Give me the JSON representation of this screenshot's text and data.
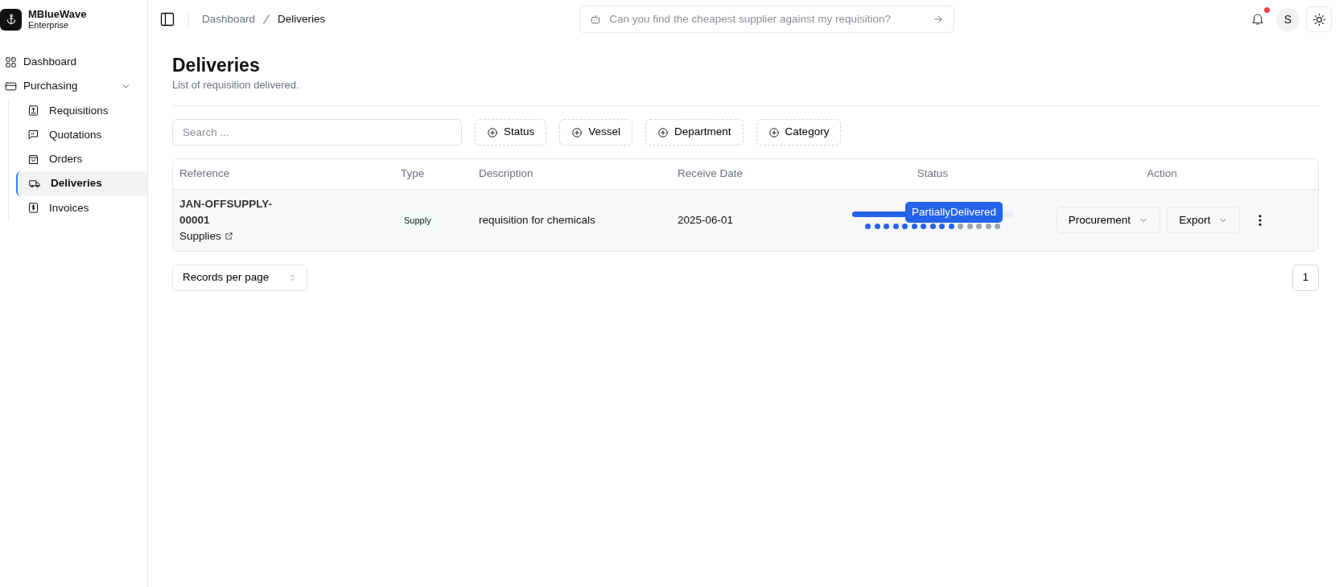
{
  "brand": {
    "name": "MBlueWave",
    "subtitle": "Enterprise"
  },
  "sidebar": {
    "items": [
      {
        "label": "Dashboard",
        "selected": false
      },
      {
        "label": "Purchasing",
        "selected": false,
        "expanded": true,
        "children": [
          {
            "label": "Requisitions",
            "selected": false
          },
          {
            "label": "Quotations",
            "selected": false
          },
          {
            "label": "Orders",
            "selected": false
          },
          {
            "label": "Deliveries",
            "selected": true
          },
          {
            "label": "Invoices",
            "selected": false
          }
        ]
      }
    ]
  },
  "breadcrumb": [
    "Dashboard",
    "Deliveries"
  ],
  "assistant": {
    "placeholder": "Can you find the cheapest supplier against my requisition?"
  },
  "notifications": {
    "unread": true
  },
  "avatar": {
    "initial": "S"
  },
  "page": {
    "title": "Deliveries",
    "subtitle": "List of requisition delivered."
  },
  "search": {
    "placeholder": "Search ..."
  },
  "filters": [
    "Status",
    "Vessel",
    "Department",
    "Category"
  ],
  "table": {
    "columns": [
      "Reference",
      "Type",
      "Description",
      "Receive Date",
      "Status",
      "Action"
    ],
    "rows": [
      {
        "reference": "JAN-OFFSUPPLY-00001",
        "group": "Supplies",
        "type": "Supply",
        "description": "requisition for chemicals",
        "receive_date": "2025-06-01",
        "status": "PartiallyDelivered",
        "level": 0.67,
        "actions": [
          "Procurement",
          "Export"
        ]
      }
    ]
  },
  "pagination": {
    "page_size_label": "Records per page",
    "pages": [
      {
        "label": "1",
        "selected": true
      }
    ]
  }
}
